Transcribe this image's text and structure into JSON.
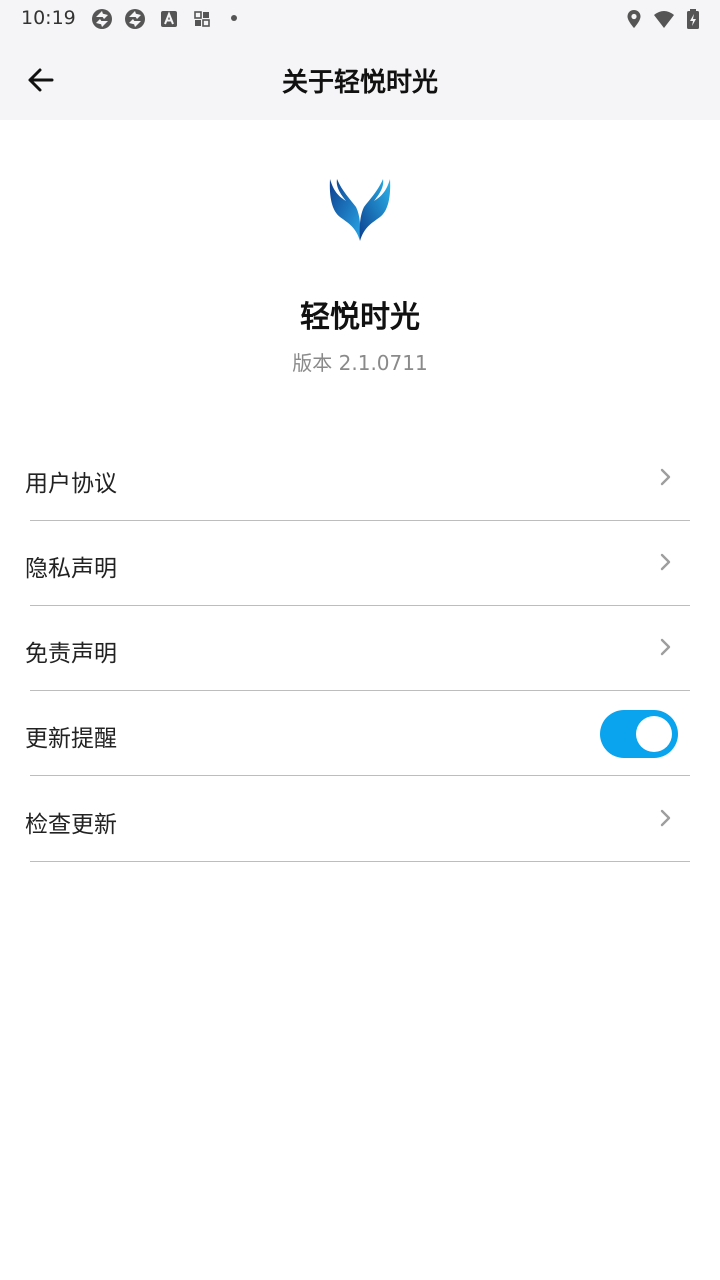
{
  "status_bar": {
    "time": "10:19",
    "left_icons": [
      "vpn-icon",
      "vpn-icon",
      "app-a-icon",
      "grid-icon",
      "dot-icon"
    ],
    "right_icons": [
      "location-icon",
      "wifi-icon",
      "battery-charging-icon"
    ]
  },
  "header": {
    "title": "关于轻悦时光",
    "back_icon": "arrow-left-icon"
  },
  "about": {
    "logo_icon": "wings-logo-icon",
    "app_name": "轻悦时光",
    "version": "版本 2.1.0711"
  },
  "menu": {
    "items": [
      {
        "label": "用户协议",
        "control": "chevron-right-icon"
      },
      {
        "label": "隐私声明",
        "control": "chevron-right-icon"
      },
      {
        "label": "免责声明",
        "control": "chevron-right-icon"
      },
      {
        "label": "更新提醒",
        "control": "toggle",
        "toggle_on": true
      },
      {
        "label": "检查更新",
        "control": "chevron-right-icon"
      }
    ]
  },
  "colors": {
    "accent": "#0aa3ee",
    "bar_background": "#f5f5f7",
    "divider": "#bdbdbd",
    "secondary_text": "#8a8a8a"
  }
}
